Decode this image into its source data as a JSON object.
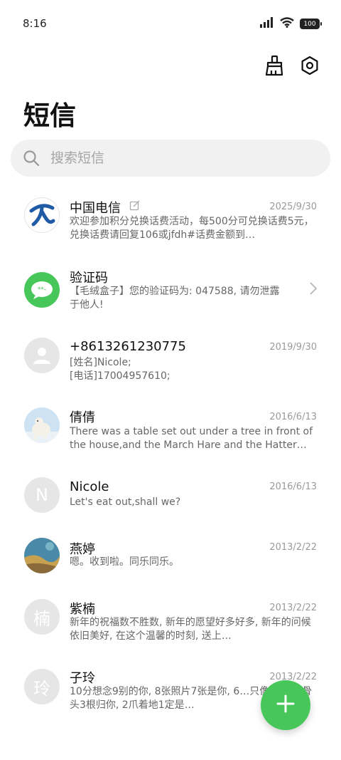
{
  "status_bar": {
    "time": "8:16",
    "battery": "100"
  },
  "header": {
    "title": "短信"
  },
  "search": {
    "placeholder": "搜索短信"
  },
  "colors": {
    "accent": "#47c75a",
    "telecom_blue": "#1e5aa6"
  },
  "conversations": [
    {
      "name": "中国电信",
      "date": "2025/9/30",
      "preview": "欢迎参加积分兑换话费活动，每500分可兑换话费5元，兑换话费请回复106或jfdh#话费金额到…",
      "avatar": "china-telecom-logo"
    },
    {
      "name": "验证码",
      "date": "",
      "preview": "【毛绒盒子】您的验证码为: 047588, 请勿泄露于他人!",
      "avatar": "verification-code-icon"
    },
    {
      "name": "+8613261230775",
      "date": "2019/9/30",
      "preview": "[姓名]Nicole;\n[电话]17004957610;",
      "avatar": "person-icon"
    },
    {
      "name": "倩倩",
      "date": "2016/6/13",
      "preview": "There was a table set out under a tree in front of the house,and the March Hare and the Hatter we…",
      "avatar": "polar-bear-photo"
    },
    {
      "name": "Nicole",
      "date": "2016/6/13",
      "preview": "Let's eat out,shall we?",
      "avatar_letter": "N"
    },
    {
      "name": "燕婷",
      "date": "2013/2/22",
      "preview": "嗯。收到啦。同乐同乐。",
      "avatar": "landscape-photo"
    },
    {
      "name": "紫楠",
      "date": "2013/2/22",
      "preview": "新年的祝福数不胜数, 新年的愿望好多好多, 新年的问候依旧美好, 在这个温馨的时刻, 送上…",
      "avatar_letter": "楠"
    },
    {
      "name": "子玲",
      "date": "2013/2/22",
      "preview": "10分想念9别的你, 8张照片7张是你, 6…只像你, 4根骨头3根归你, 2爪着地1定是…",
      "avatar_letter": "玲"
    }
  ]
}
